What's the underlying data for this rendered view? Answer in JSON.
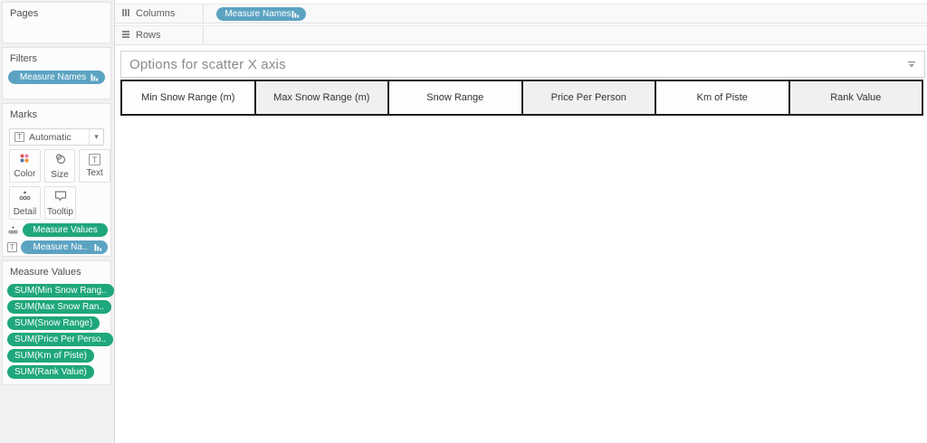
{
  "sidebar": {
    "pages_title": "Pages",
    "filters_title": "Filters",
    "filters_pill": "Measure Names",
    "marks_title": "Marks",
    "marks_dropdown_value": "Automatic",
    "marks_buttons": {
      "color": "Color",
      "size": "Size",
      "text": "Text",
      "detail": "Detail",
      "tooltip": "Tooltip"
    },
    "marks_pill_measure_values": "Measure Values",
    "marks_pill_measure_names": "Measure Na..",
    "measure_values_title": "Measure Values",
    "measure_pills": [
      "SUM(Min Snow Rang..",
      "SUM(Max Snow Ran..",
      "SUM(Snow Range)",
      "SUM(Price Per Perso..",
      "SUM(Km of Piste)",
      "SUM(Rank Value)"
    ]
  },
  "shelves": {
    "columns_label": "Columns",
    "rows_label": "Rows",
    "columns_pill": "Measure Names"
  },
  "main": {
    "parameter_title": "Options for scatter X axis",
    "table_headers": [
      "Min Snow Range (m)",
      "Max Snow Range (m)",
      "Snow Range",
      "Price Per Person",
      "Km of Piste",
      "Rank Value"
    ]
  },
  "icons": {
    "sort": "sort-descending-bars",
    "text": "T-in-box",
    "dropdown_caret": "caret-down",
    "columns": "three-vertical-bars",
    "rows": "three-horizontal-bars",
    "color": "four-colored-dots",
    "size": "overlapping-circles",
    "detail": "dots",
    "tooltip": "speech-bubble",
    "parameter_caret": "line-over-caret"
  },
  "colors": {
    "pill_blue": "#5ca3c2",
    "pill_green": "#1fa77c",
    "table_border": "#1d1d1d",
    "dot_red": "#e15759",
    "dot_pink": "#e87dab",
    "dot_blue": "#4e79a7",
    "dot_orange": "#f28e2b"
  }
}
